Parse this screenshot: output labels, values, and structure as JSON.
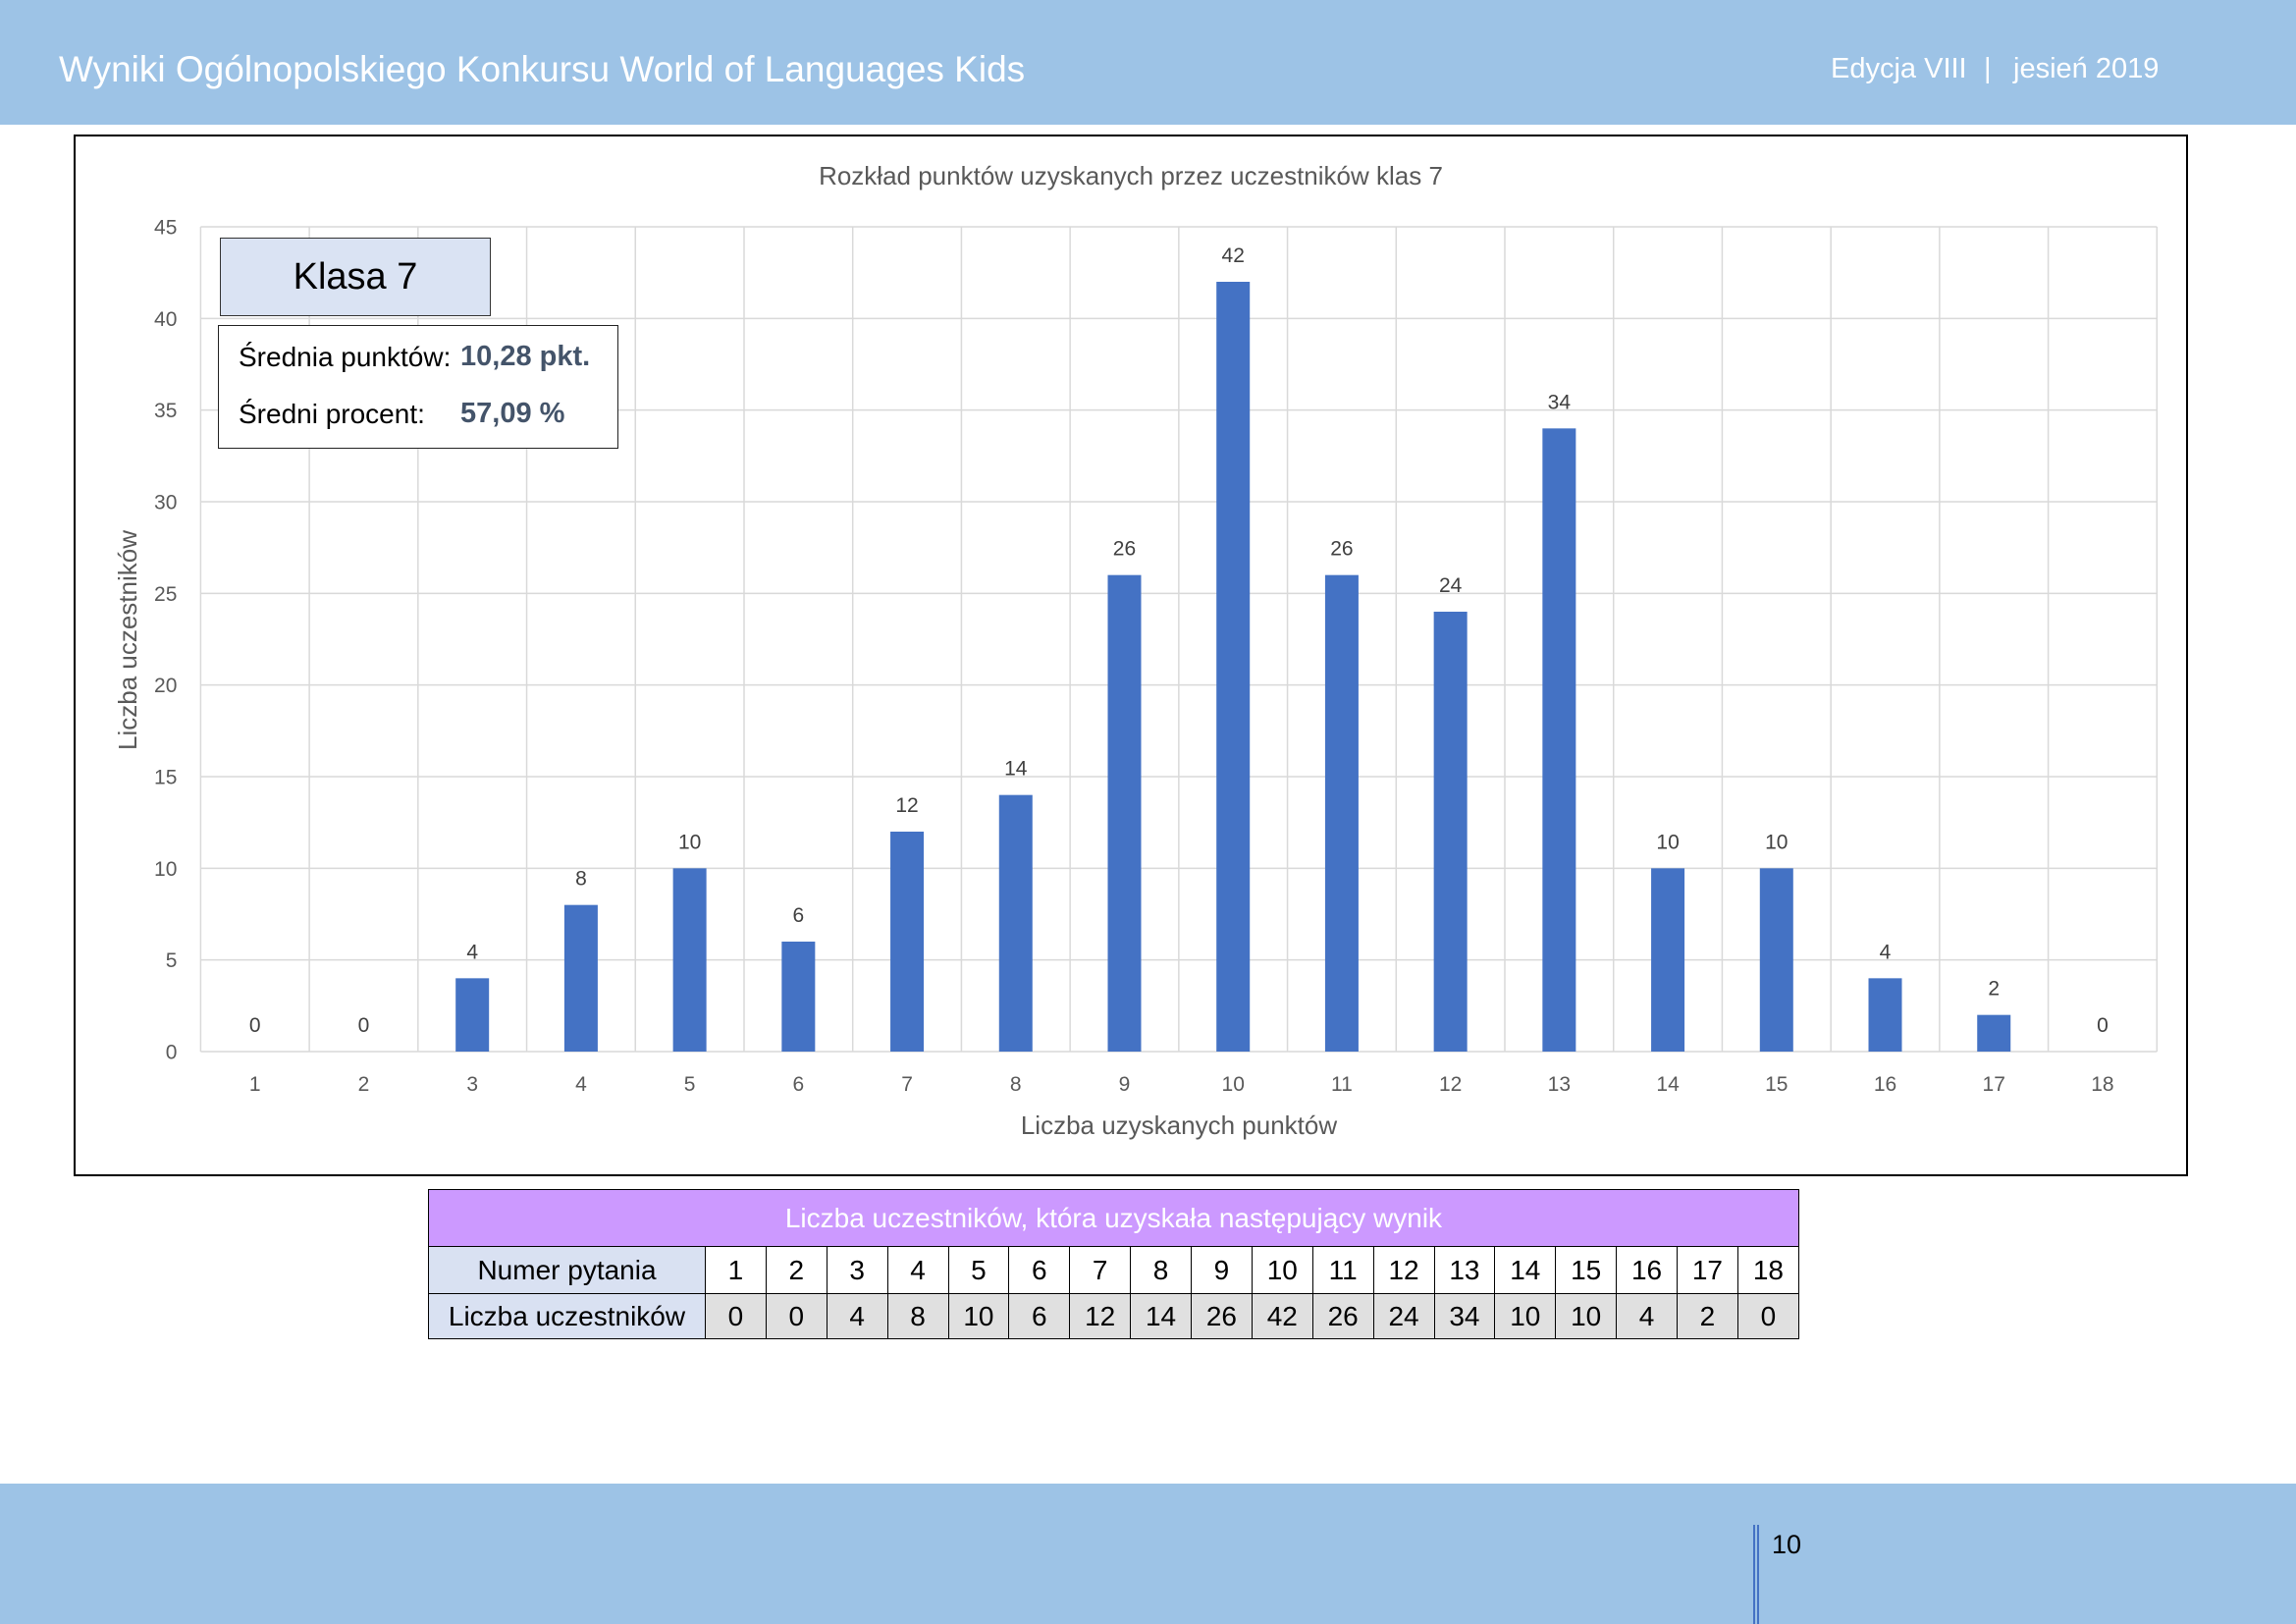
{
  "header": {
    "title": "Wyniki Ogólnopolskiego Konkursu World of Languages Kids",
    "edition": "Edycja VIII",
    "separator": "|",
    "season": "jesień 2019"
  },
  "chart_data": {
    "type": "bar",
    "title": "Rozkład punktów uzyskanych przez uczestników klas 7",
    "xlabel": "Liczba uzyskanych punktów",
    "ylabel": "Liczba uczestników",
    "categories": [
      "1",
      "2",
      "3",
      "4",
      "5",
      "6",
      "7",
      "8",
      "9",
      "10",
      "11",
      "12",
      "13",
      "14",
      "15",
      "16",
      "17",
      "18"
    ],
    "values": [
      0,
      0,
      4,
      8,
      10,
      6,
      12,
      14,
      26,
      42,
      26,
      24,
      34,
      10,
      10,
      4,
      2,
      0
    ],
    "data_labels": true,
    "ylim": [
      0,
      45
    ],
    "yticks": [
      0,
      5,
      10,
      15,
      20,
      25,
      30,
      35,
      40,
      45
    ],
    "grid": true,
    "legend": "none",
    "bar_color": "#4472C4"
  },
  "class_box": {
    "label": "Klasa 7"
  },
  "stats": {
    "avg_points_label": "Średnia punktów:",
    "avg_points_value": "10,28 pkt.",
    "avg_percent_label": "Średni procent:",
    "avg_percent_value": "57,09 %"
  },
  "table": {
    "caption": "Liczba uczestników, która uzyskała następujący wynik",
    "row1_label": "Numer pytania",
    "row2_label": "Liczba uczestników",
    "numbers": [
      1,
      2,
      3,
      4,
      5,
      6,
      7,
      8,
      9,
      10,
      11,
      12,
      13,
      14,
      15,
      16,
      17,
      18
    ],
    "counts": [
      0,
      0,
      4,
      8,
      10,
      6,
      12,
      14,
      26,
      42,
      26,
      24,
      34,
      10,
      10,
      4,
      2,
      0
    ]
  },
  "footer": {
    "page_number": "10"
  },
  "colors": {
    "header_band": "#9DC3E6",
    "footer_band": "#9DC3E6",
    "bar": "#4472C4",
    "table_caption_bg": "#CC99FF",
    "table_label_bg": "#D9E1F2",
    "table_count_bg": "#E0E0E0",
    "class_box_bg": "#DAE3F3",
    "stat_value": "#44546A"
  }
}
